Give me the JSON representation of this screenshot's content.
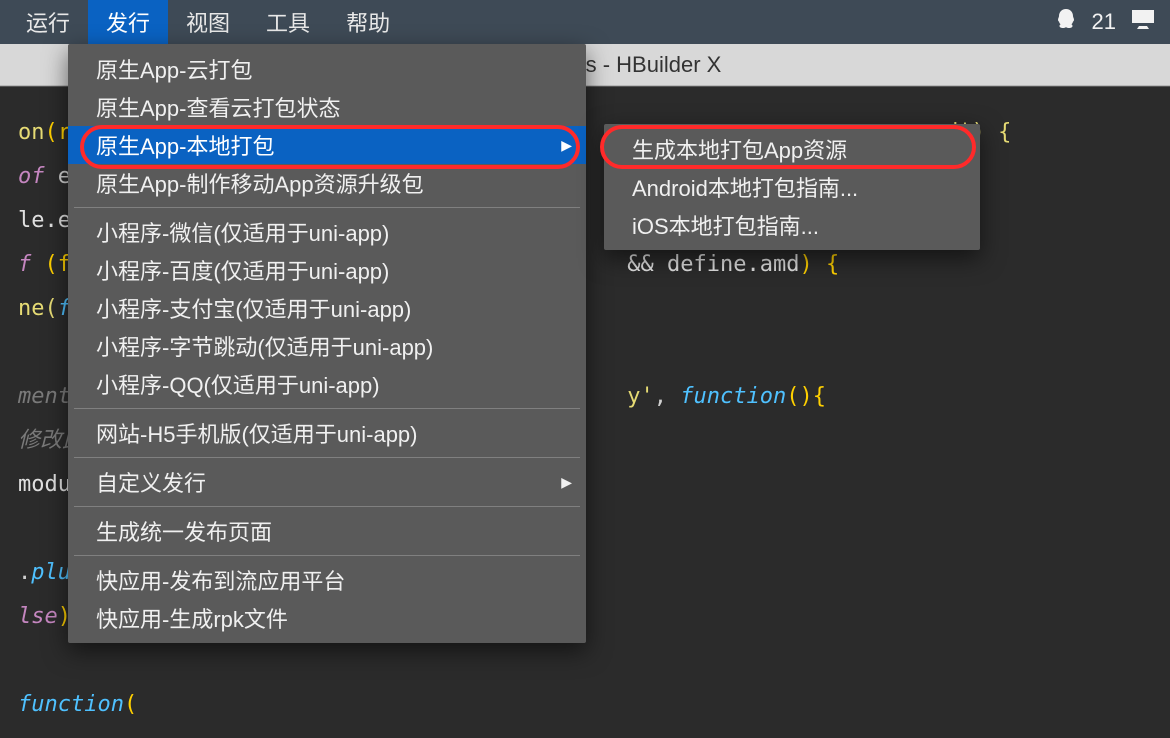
{
  "menubar": {
    "items": [
      {
        "label": "运行",
        "active": false
      },
      {
        "label": "发行",
        "active": true
      },
      {
        "label": "视图",
        "active": false
      },
      {
        "label": "工具",
        "active": false
      },
      {
        "label": "帮助",
        "active": false
      }
    ],
    "tray_count": "21"
  },
  "titlebar": {
    "text": "mmon/plugin.js - HBuilder X"
  },
  "menu_main": [
    {
      "type": "item",
      "label": "原生App-云打包"
    },
    {
      "type": "item",
      "label": "原生App-查看云打包状态"
    },
    {
      "type": "item",
      "label": "原生App-本地打包",
      "hasSubmenu": true,
      "highlight": true
    },
    {
      "type": "item",
      "label": "原生App-制作移动App资源升级包"
    },
    {
      "type": "sep"
    },
    {
      "type": "item",
      "label": "小程序-微信(仅适用于uni-app)"
    },
    {
      "type": "item",
      "label": "小程序-百度(仅适用于uni-app)"
    },
    {
      "type": "item",
      "label": "小程序-支付宝(仅适用于uni-app)"
    },
    {
      "type": "item",
      "label": "小程序-字节跳动(仅适用于uni-app)"
    },
    {
      "type": "item",
      "label": "小程序-QQ(仅适用于uni-app)"
    },
    {
      "type": "sep"
    },
    {
      "type": "item",
      "label": "网站-H5手机版(仅适用于uni-app)"
    },
    {
      "type": "sep"
    },
    {
      "type": "item",
      "label": "自定义发行",
      "hasSubmenu": true
    },
    {
      "type": "sep"
    },
    {
      "type": "item",
      "label": "生成统一发布页面"
    },
    {
      "type": "sep"
    },
    {
      "type": "item",
      "label": "快应用-发布到流应用平台"
    },
    {
      "type": "item",
      "label": "快应用-生成rpk文件"
    }
  ],
  "menu_sub": [
    {
      "type": "item",
      "label": "生成本地打包App资源"
    },
    {
      "type": "item",
      "label": "Android本地打包指南..."
    },
    {
      "type": "item",
      "label": "iOS本地打包指南..."
    }
  ],
  "code": {
    "l1a": "on",
    "l1b": "(r",
    "l2a": "of",
    "l2b": " e",
    "l3a": "le.e",
    "l4a": "f ",
    "l4b": "(f",
    "l5a": "ne(",
    "l5b": "f",
    "l6a": "ment",
    "l6b": "修改此",
    "l7a": "modu",
    "l8a": ".",
    "l8b": "plu",
    "l9a": "lse",
    "l9b": ")",
    "l10a": "function",
    "l10b": "(",
    "r1": "ned') {",
    "r2a": "&& define.amd",
    "r2b": ") {",
    "r3a": "y'",
    "r3b": ", ",
    "r3c": "function",
    "r3d": "(){"
  }
}
